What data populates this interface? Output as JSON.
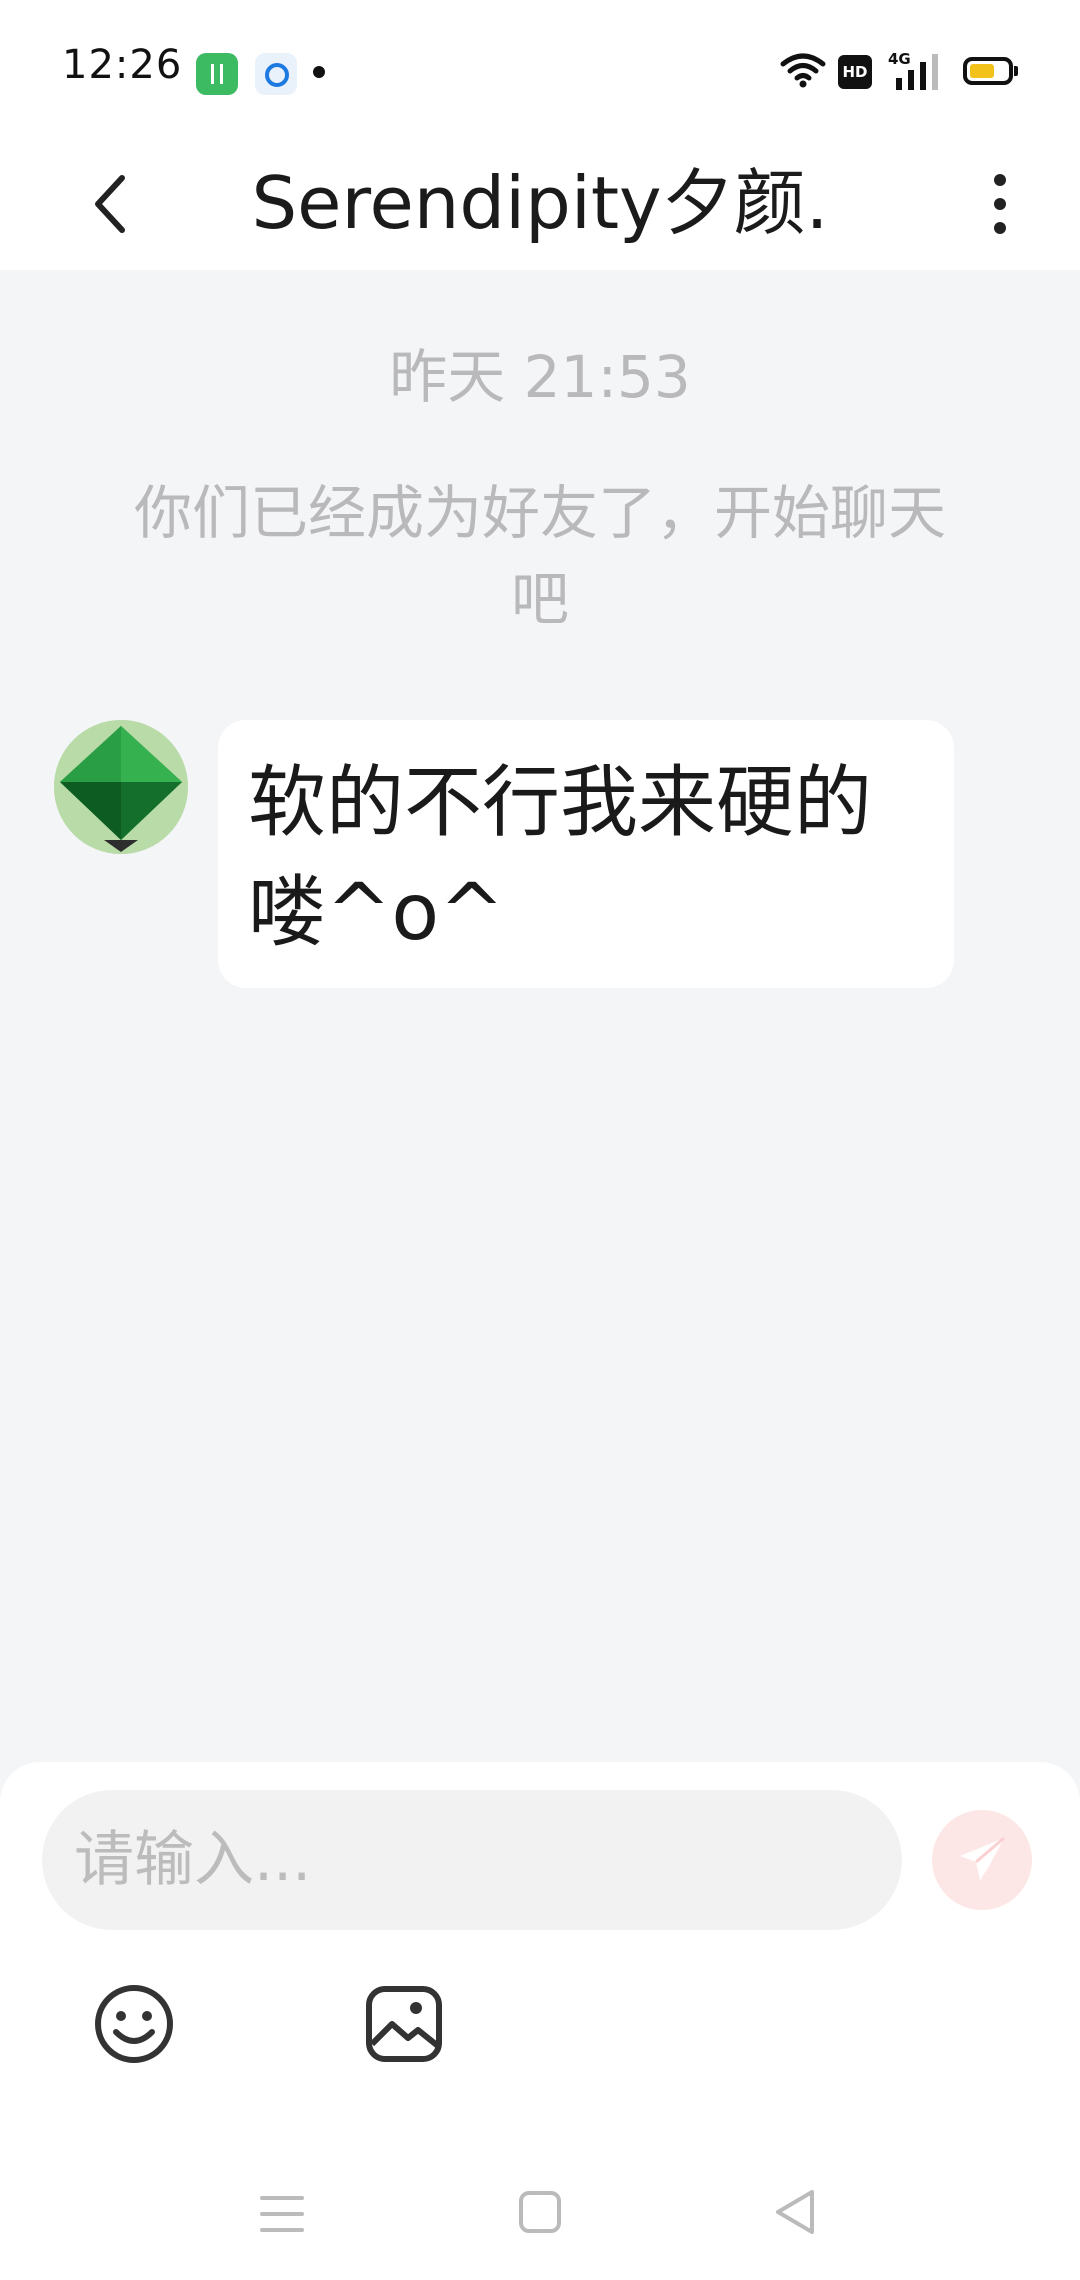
{
  "status_bar": {
    "time": "12:26",
    "hd_badge": "HD",
    "network": "4G",
    "icons": [
      "green-app-icon",
      "blue-app-icon",
      "notification-dot",
      "wifi-icon",
      "signal-icon",
      "battery-icon"
    ]
  },
  "header": {
    "title": "Serendipity夕颜.",
    "back_icon": "chevron-left-icon",
    "more_icon": "more-vertical-icon"
  },
  "chat": {
    "timestamp": "昨天 21:53",
    "system_message": "你们已经成为好友了，开始聊天吧",
    "messages": [
      {
        "sender": "other",
        "avatar_icon": "green-gem-avatar",
        "text": "软的不行我来硬的喽^o^"
      }
    ]
  },
  "composer": {
    "placeholder": "请输入...",
    "send_icon": "send-icon",
    "send_color": "#fde6e6",
    "tools": [
      {
        "icon": "emoji-icon"
      },
      {
        "icon": "image-icon"
      }
    ]
  },
  "nav_bar": {
    "icons": [
      "menu-icon",
      "home-icon",
      "back-triangle-icon"
    ]
  }
}
